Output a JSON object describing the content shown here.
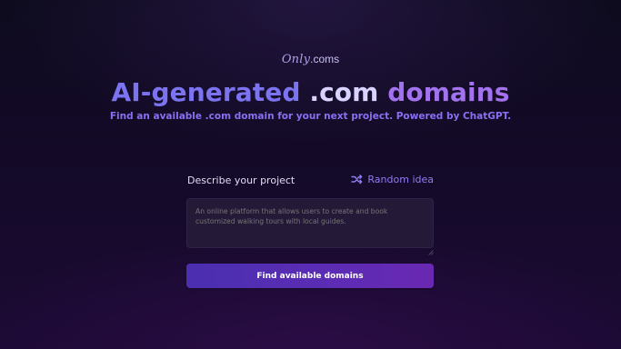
{
  "brand": {
    "logo_script": "Only",
    "logo_suffix": ".coms"
  },
  "hero": {
    "title_part1": "AI-generated",
    "title_part2": ".com",
    "title_part3": "domains",
    "subtitle": "Find an available .com domain for your next project. Powered by ChatGPT."
  },
  "form": {
    "description_label": "Describe your project",
    "random_idea_label": "Random idea",
    "random_idea_icon": "shuffle-icon",
    "description_value": "",
    "description_placeholder": "An online platform that allows users to create and book customized walking tours with local guides.",
    "submit_label": "Find available domains"
  },
  "colors": {
    "accent_blue": "#7b73f0",
    "accent_light": "#d9d3ff",
    "accent_purple": "#a372ee",
    "subtitle": "#8b6ff2",
    "button_start": "#4a2fb0",
    "button_end": "#6a28b2"
  }
}
